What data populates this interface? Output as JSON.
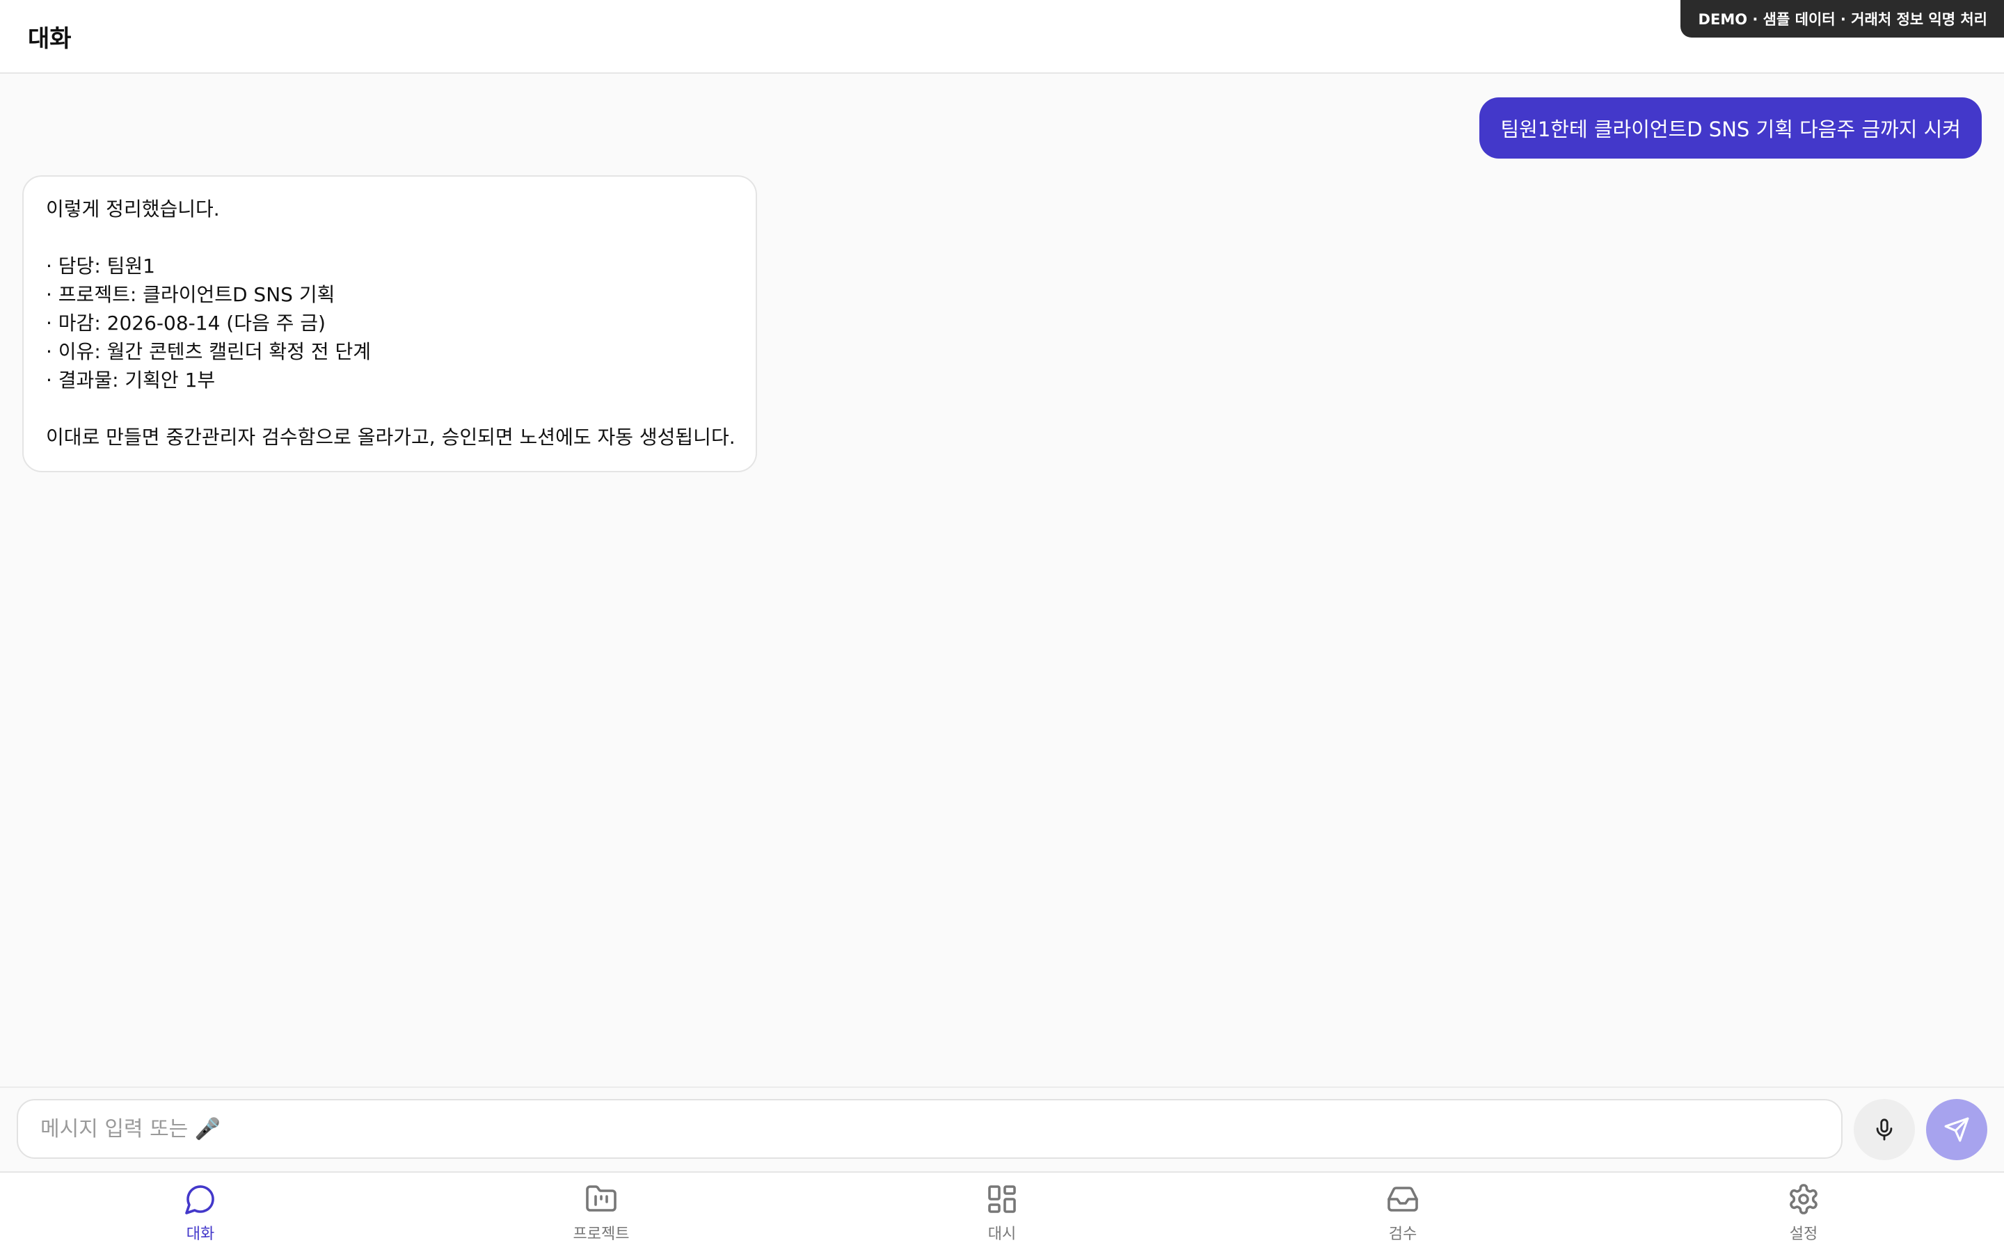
{
  "header": {
    "title": "대화",
    "demo_badge": "DEMO · 샘플 데이터 · 거래처 정보 익명 처리"
  },
  "chat": {
    "user_message": "팀원1한테 클라이언트D SNS 기획 다음주 금까지 시켜",
    "assistant_message": {
      "intro": "이렇게 정리했습니다.",
      "items": [
        "· 담당: 팀원1",
        "· 프로젝트: 클라이언트D SNS 기획",
        "· 마감: 2026-08-14 (다음 주 금)",
        "· 이유: 월간 콘텐츠 캘린더 확정 전 단계",
        "· 결과물: 기획안 1부"
      ],
      "outro": "이대로 만들면 중간관리자 검수함으로 올라가고, 승인되면 노션에도 자동 생성됩니다."
    }
  },
  "composer": {
    "placeholder": "메시지 입력 또는 🎤",
    "value": ""
  },
  "nav": {
    "items": [
      {
        "label": "대화",
        "icon": "chat-bubble-icon",
        "active": true
      },
      {
        "label": "프로젝트",
        "icon": "folder-chart-icon",
        "active": false
      },
      {
        "label": "대시",
        "icon": "dashboard-grid-icon",
        "active": false
      },
      {
        "label": "검수",
        "icon": "inbox-tray-icon",
        "active": false
      },
      {
        "label": "설정",
        "icon": "gear-icon",
        "active": false
      }
    ]
  },
  "colors": {
    "accent": "#4338ca",
    "send_disabled": "#a7a3ee",
    "badge_bg": "#2b2b2b"
  }
}
